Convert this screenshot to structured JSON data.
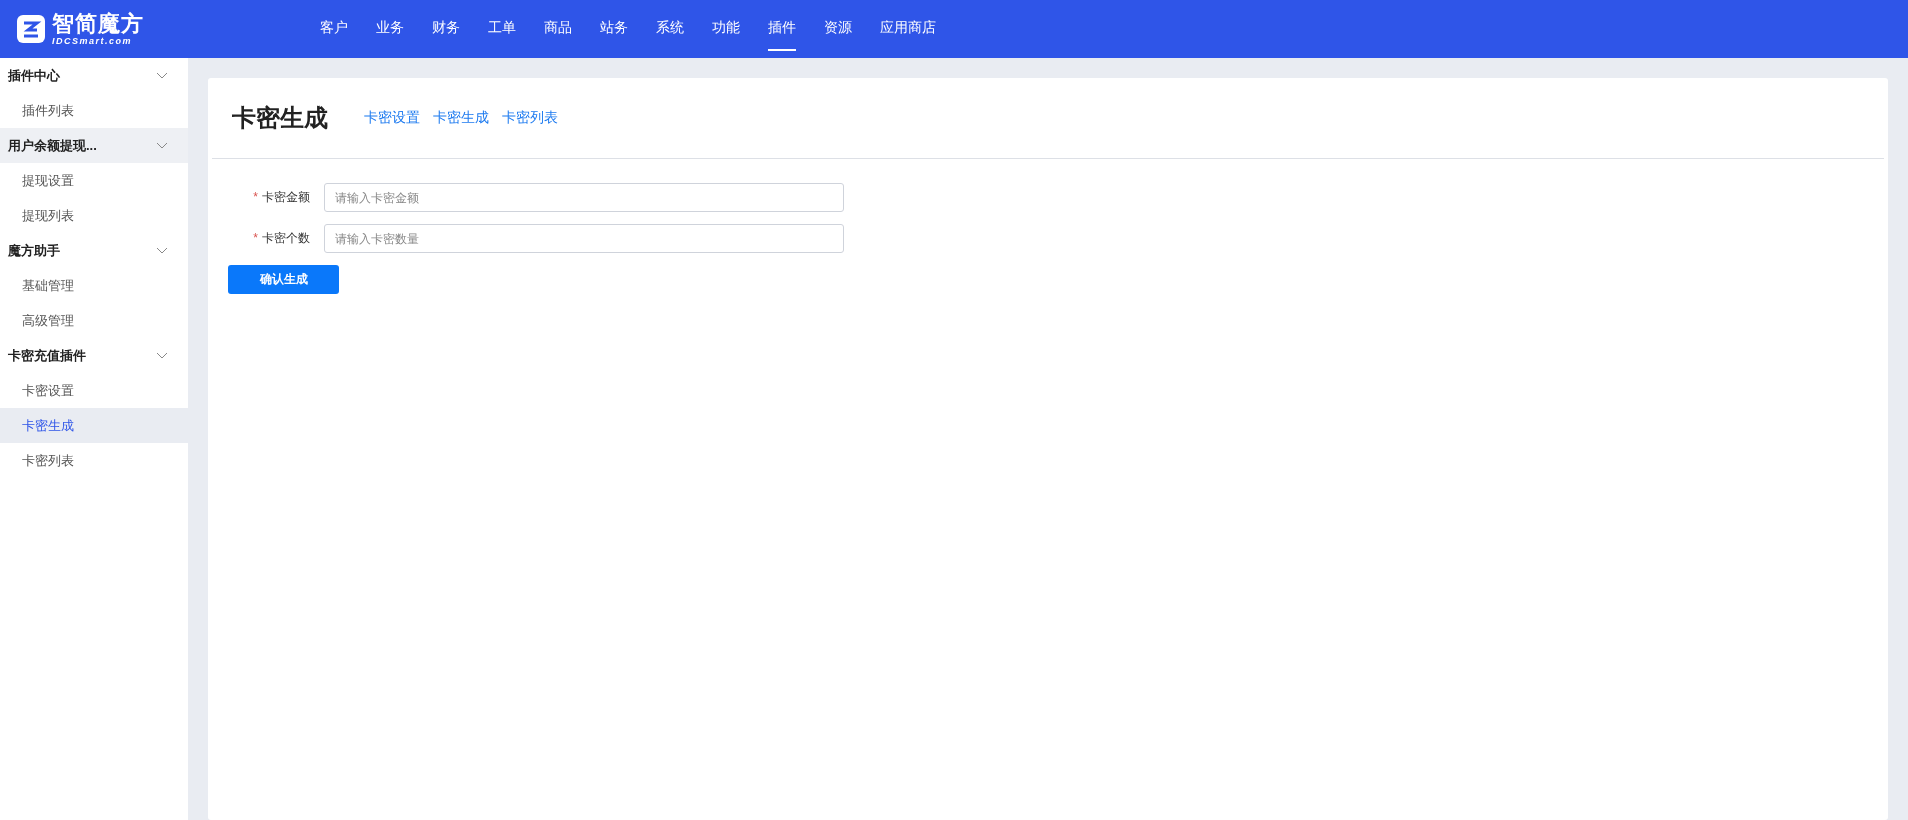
{
  "logo": {
    "name": "智简魔方",
    "subtitle": "IDCSmart.com"
  },
  "nav": [
    {
      "label": "客户",
      "selected": false
    },
    {
      "label": "业务",
      "selected": false
    },
    {
      "label": "财务",
      "selected": false
    },
    {
      "label": "工单",
      "selected": false
    },
    {
      "label": "商品",
      "selected": false
    },
    {
      "label": "站务",
      "selected": false
    },
    {
      "label": "系统",
      "selected": false
    },
    {
      "label": "功能",
      "selected": false
    },
    {
      "label": "插件",
      "selected": true
    },
    {
      "label": "资源",
      "selected": false
    },
    {
      "label": "应用商店",
      "selected": false
    }
  ],
  "sidebar": {
    "groups": [
      {
        "label": "插件中心",
        "expanded": true,
        "hovered": false,
        "children": [
          {
            "label": "插件列表",
            "selected": false
          }
        ]
      },
      {
        "label": "用户余额提现...",
        "expanded": true,
        "hovered": true,
        "children": [
          {
            "label": "提现设置",
            "selected": false
          },
          {
            "label": "提现列表",
            "selected": false
          }
        ]
      },
      {
        "label": "魔方助手",
        "expanded": true,
        "hovered": false,
        "children": [
          {
            "label": "基础管理",
            "selected": false
          },
          {
            "label": "高级管理",
            "selected": false
          }
        ]
      },
      {
        "label": "卡密充值插件",
        "expanded": true,
        "hovered": false,
        "children": [
          {
            "label": "卡密设置",
            "selected": false
          },
          {
            "label": "卡密生成",
            "selected": true
          },
          {
            "label": "卡密列表",
            "selected": false
          }
        ]
      }
    ]
  },
  "page": {
    "title": "卡密生成",
    "links": [
      "卡密设置",
      "卡密生成",
      "卡密列表"
    ],
    "form": {
      "fields": [
        {
          "label": "卡密金额",
          "required_mark": "*",
          "placeholder": "请输入卡密金额"
        },
        {
          "label": "卡密个数",
          "required_mark": "*",
          "placeholder": "请输入卡密数量"
        }
      ],
      "submit": "确认生成"
    }
  }
}
